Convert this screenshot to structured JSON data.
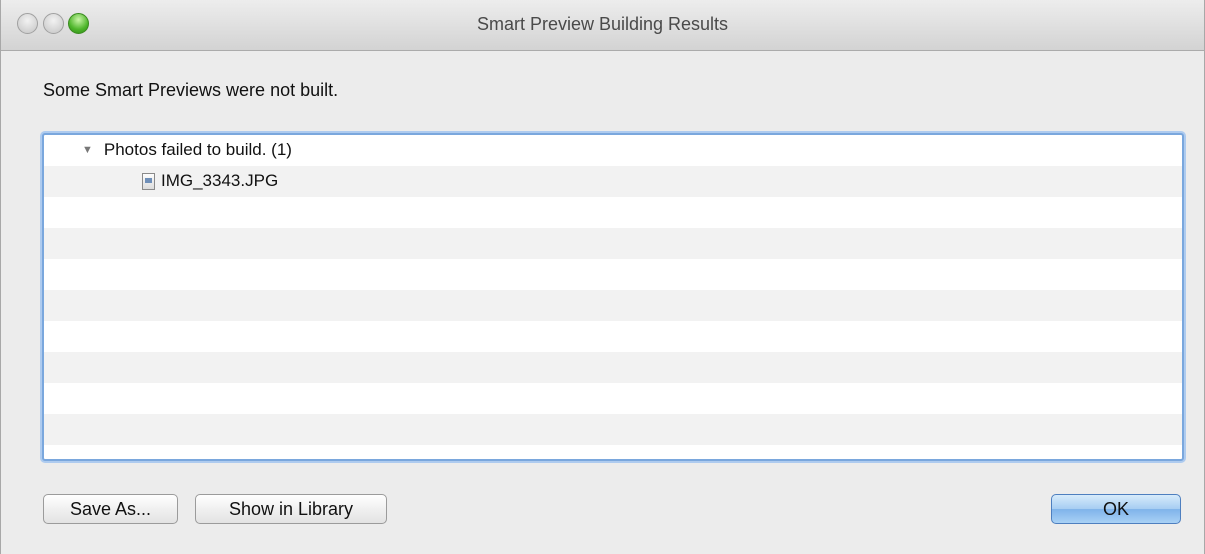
{
  "window": {
    "title": "Smart Preview Building Results"
  },
  "message": "Some Smart Previews were not built.",
  "tree": {
    "group_label": "Photos failed to build. (1)",
    "group_icon": "disclosure-triangle-expanded",
    "items": [
      {
        "name": "IMG_3343.JPG",
        "icon": "jpg-file-icon"
      }
    ]
  },
  "buttons": {
    "save_as": "Save As...",
    "show_in_library": "Show in Library",
    "ok": "OK"
  },
  "colors": {
    "focus_ring": "#7aa7dd",
    "default_button": "#a6cdf2",
    "zoom_button": "#4db52a"
  }
}
